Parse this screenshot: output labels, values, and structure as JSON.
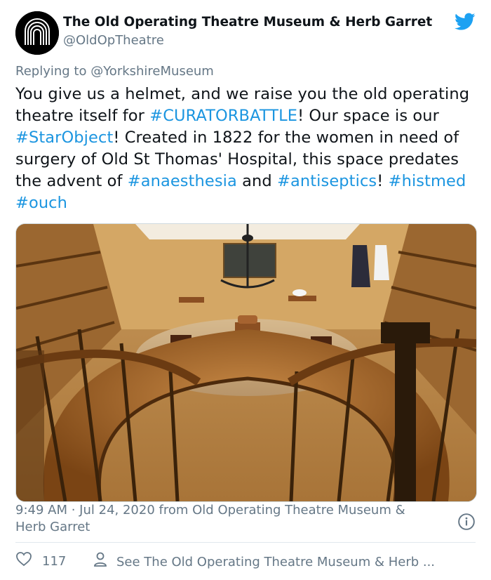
{
  "account": {
    "display_name": "The Old Operating Theatre Museum & Herb Garret",
    "handle": "@OldOpTheatre"
  },
  "reply": {
    "label": "Replying to ",
    "to": "@YorkshireMuseum"
  },
  "tweet": {
    "parts": [
      {
        "text": "You give us a helmet, and we raise you the old operating theatre itself for ",
        "tag": false
      },
      {
        "text": "#CURATORBATTLE",
        "tag": true
      },
      {
        "text": "! Our space is our ",
        "tag": false
      },
      {
        "text": "#StarObject",
        "tag": true
      },
      {
        "text": "! Created in 1822 for the women in need of surgery of Old St Thomas' Hospital, this space predates the advent of ",
        "tag": false
      },
      {
        "text": "#anaesthesia",
        "tag": true
      },
      {
        "text": " and ",
        "tag": false
      },
      {
        "text": "#antiseptics",
        "tag": true
      },
      {
        "text": "! ",
        "tag": false
      },
      {
        "text": "#histmed",
        "tag": true
      },
      {
        "text": " ",
        "tag": false
      },
      {
        "text": "#ouch",
        "tag": true
      }
    ]
  },
  "meta": {
    "time": "9:49 AM",
    "separator": " · ",
    "date": "Jul 24, 2020",
    "source_prefix": " from ",
    "source": "Old Operating Theatre Museum & Herb Garret"
  },
  "actions": {
    "likes": "117",
    "see_more": "See The Old Operating Theatre Museum & Herb ..."
  },
  "colors": {
    "link": "#1b95e0",
    "secondary": "#657786",
    "twitter_blue": "#1da1f2"
  },
  "icons": [
    "twitter-bird-icon",
    "info-icon",
    "heart-icon",
    "person-icon"
  ]
}
